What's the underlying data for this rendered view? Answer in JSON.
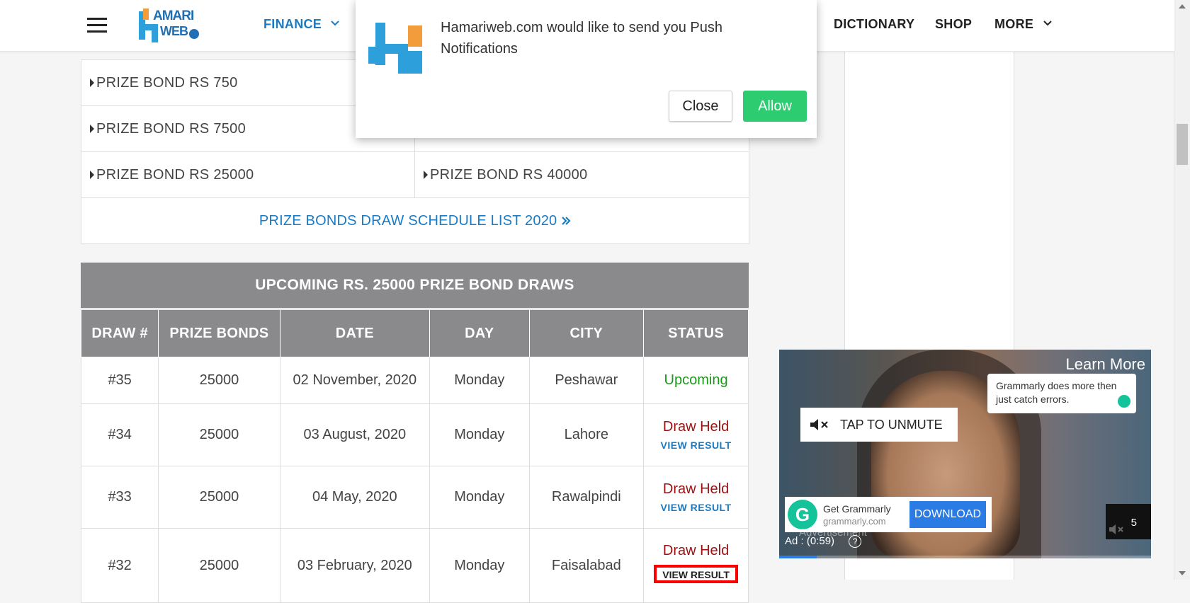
{
  "header": {
    "logo_top": "AMARI",
    "logo_bottom": "WEB",
    "nav": {
      "finance": "FINANCE",
      "dictionary": "DICTIONARY",
      "shop": "SHOP",
      "more": "MORE"
    }
  },
  "bond_links": {
    "rows": [
      [
        "PRIZE BOND RS 750",
        ""
      ],
      [
        "PRIZE BOND RS 7500",
        ""
      ],
      [
        "PRIZE BOND RS 25000",
        "PRIZE BOND RS 40000"
      ]
    ],
    "schedule_link": "PRIZE BONDS DRAW SCHEDULE LIST 2020"
  },
  "draws": {
    "title": "UPCOMING RS. 25000 PRIZE BOND DRAWS",
    "columns": [
      "DRAW #",
      "PRIZE BONDS",
      "DATE",
      "DAY",
      "CITY",
      "STATUS"
    ],
    "rows": [
      {
        "draw": "#35",
        "bonds": "25000",
        "date": "02 November, 2020",
        "day": "Monday",
        "city": "Peshawar",
        "status": "Upcoming",
        "link": ""
      },
      {
        "draw": "#34",
        "bonds": "25000",
        "date": "03 August, 2020",
        "day": "Monday",
        "city": "Lahore",
        "status": "Draw Held",
        "link": "VIEW RESULT"
      },
      {
        "draw": "#33",
        "bonds": "25000",
        "date": "04 May, 2020",
        "day": "Monday",
        "city": "Rawalpindi",
        "status": "Draw Held",
        "link": "VIEW RESULT"
      },
      {
        "draw": "#32",
        "bonds": "25000",
        "date": "03 February, 2020",
        "day": "Monday",
        "city": "Faisalabad",
        "status": "Draw Held",
        "link": "VIEW RESULT"
      }
    ]
  },
  "notification": {
    "message": "Hamariweb.com would like to send you Push Notifications",
    "close_label": "Close",
    "allow_label": "Allow"
  },
  "ad": {
    "learn_more": "Learn More",
    "bubble_text": "Grammarly does more then just catch errors.",
    "unmute_label": "TAP TO UNMUTE",
    "brand_title": "Get Grammarly",
    "brand_domain": "grammarly.com",
    "download_label": "DOWNLOAD",
    "ad_time": "Ad : (0:59)",
    "faded_label": "Advertisement",
    "skip_count": "5",
    "progress": 0.1
  },
  "colors": {
    "accent": "#1a7bc4",
    "upcoming": "#1a9a1a",
    "held": "#9b1010",
    "allow": "#2ecc71"
  }
}
